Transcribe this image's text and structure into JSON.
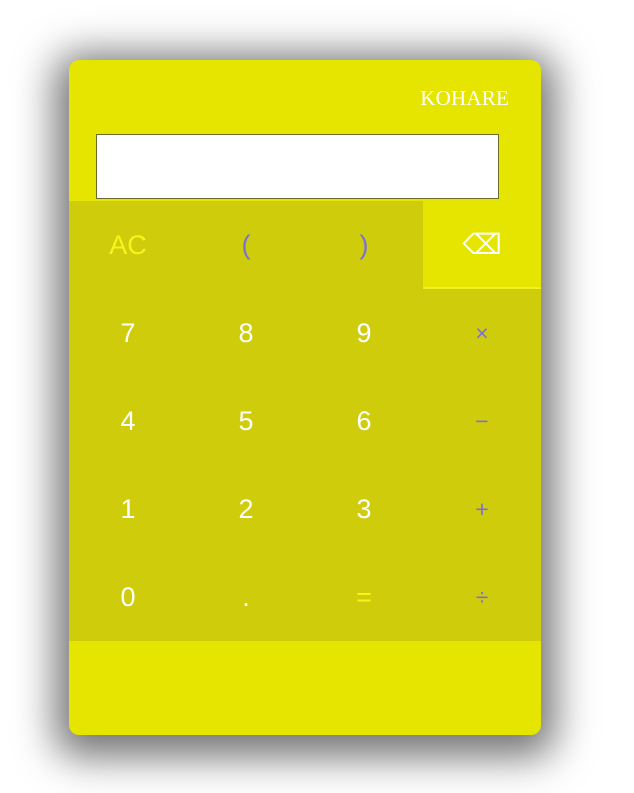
{
  "brand": "KOHARE",
  "display": {
    "value": "",
    "placeholder": ""
  },
  "colors": {
    "body": "#e5e500",
    "keypad": "#cfcc0c",
    "digit_text": "#ffffff",
    "operator_text": "#7d6fd8",
    "accent_text": "#f5f51a"
  },
  "keys": {
    "clear": "AC",
    "open_paren": "(",
    "close_paren": ")",
    "backspace": "⌫",
    "seven": "7",
    "eight": "8",
    "nine": "9",
    "multiply": "×",
    "four": "4",
    "five": "5",
    "six": "6",
    "subtract": "−",
    "one": "1",
    "two": "2",
    "three": "3",
    "add": "+",
    "zero": "0",
    "decimal": ".",
    "equals": "=",
    "divide": "÷"
  }
}
